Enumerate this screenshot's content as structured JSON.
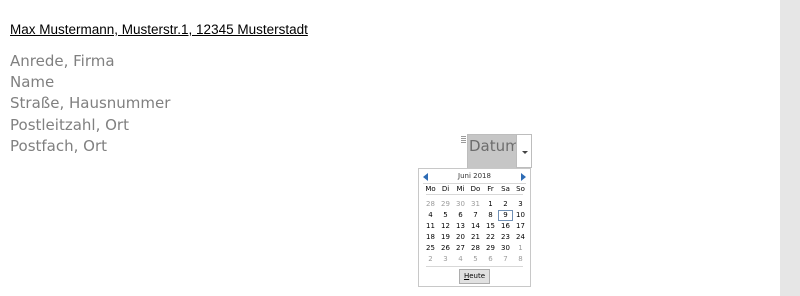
{
  "document": {
    "sender_line": "Max Mustermann, Musterstr.1, 12345 Musterstadt",
    "address_lines": [
      "Anrede, Firma",
      "Name",
      "Straße, Hausnummer",
      "Postleitzahl, Ort",
      "Postfach, Ort"
    ]
  },
  "date_control": {
    "placeholder": "Datum",
    "icon": "chevron-down-icon"
  },
  "calendar": {
    "month_title": "Juni 2018",
    "prev_icon": "arrow-left-icon",
    "next_icon": "arrow-right-icon",
    "weekdays": [
      "Mo",
      "Di",
      "Mi",
      "Do",
      "Fr",
      "Sa",
      "So"
    ],
    "weeks": [
      [
        {
          "d": "28",
          "m": true
        },
        {
          "d": "29",
          "m": true
        },
        {
          "d": "30",
          "m": true
        },
        {
          "d": "31",
          "m": true
        },
        {
          "d": "1"
        },
        {
          "d": "2"
        },
        {
          "d": "3"
        }
      ],
      [
        {
          "d": "4"
        },
        {
          "d": "5"
        },
        {
          "d": "6"
        },
        {
          "d": "7"
        },
        {
          "d": "8"
        },
        {
          "d": "9",
          "s": true
        },
        {
          "d": "10"
        }
      ],
      [
        {
          "d": "11"
        },
        {
          "d": "12"
        },
        {
          "d": "13"
        },
        {
          "d": "14"
        },
        {
          "d": "15"
        },
        {
          "d": "16"
        },
        {
          "d": "17"
        }
      ],
      [
        {
          "d": "18"
        },
        {
          "d": "19"
        },
        {
          "d": "20"
        },
        {
          "d": "21"
        },
        {
          "d": "22"
        },
        {
          "d": "23"
        },
        {
          "d": "24"
        }
      ],
      [
        {
          "d": "25"
        },
        {
          "d": "26"
        },
        {
          "d": "27"
        },
        {
          "d": "28"
        },
        {
          "d": "29"
        },
        {
          "d": "30"
        },
        {
          "d": "1",
          "m": true
        }
      ],
      [
        {
          "d": "2",
          "m": true
        },
        {
          "d": "3",
          "m": true
        },
        {
          "d": "4",
          "m": true
        },
        {
          "d": "5",
          "m": true
        },
        {
          "d": "6",
          "m": true
        },
        {
          "d": "7",
          "m": true
        },
        {
          "d": "8",
          "m": true
        }
      ]
    ],
    "today_button": {
      "accel": "H",
      "rest": "eute"
    },
    "selected_color": "#6f8fb5",
    "nav_color": "#2e6cb5"
  }
}
